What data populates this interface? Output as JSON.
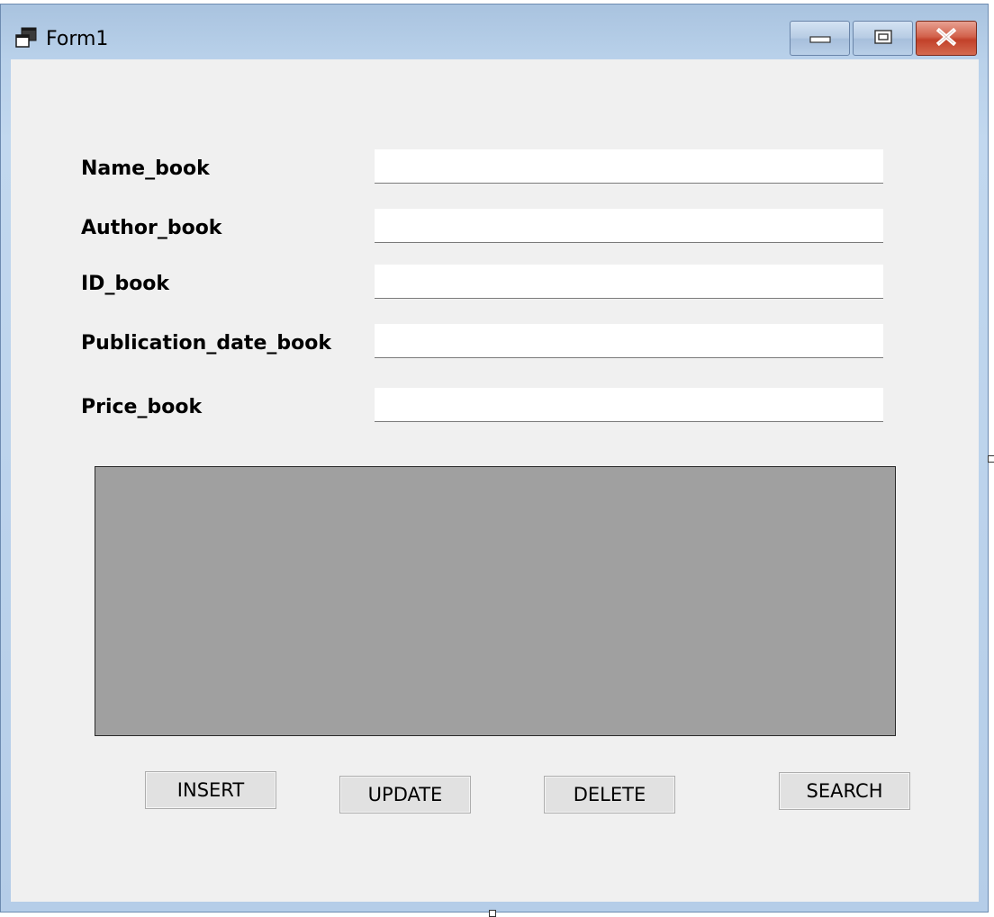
{
  "window": {
    "title": "Form1",
    "icons": {
      "app": "form-icon",
      "minimize": "minimize-icon",
      "maximize": "maximize-icon",
      "close": "close-icon"
    }
  },
  "form": {
    "fields": [
      {
        "label": "Name_book",
        "value": ""
      },
      {
        "label": "Author_book",
        "value": ""
      },
      {
        "label": "ID_book",
        "value": ""
      },
      {
        "label": "Publication_date_book",
        "value": ""
      },
      {
        "label": "Price_book",
        "value": ""
      }
    ]
  },
  "buttons": {
    "insert": "INSERT",
    "update": "UPDATE",
    "delete": "DELETE",
    "search": "SEARCH"
  },
  "colors": {
    "client_background": "#f0f0f0",
    "grid_background": "#a0a0a0",
    "close_button": "#c94a33"
  }
}
